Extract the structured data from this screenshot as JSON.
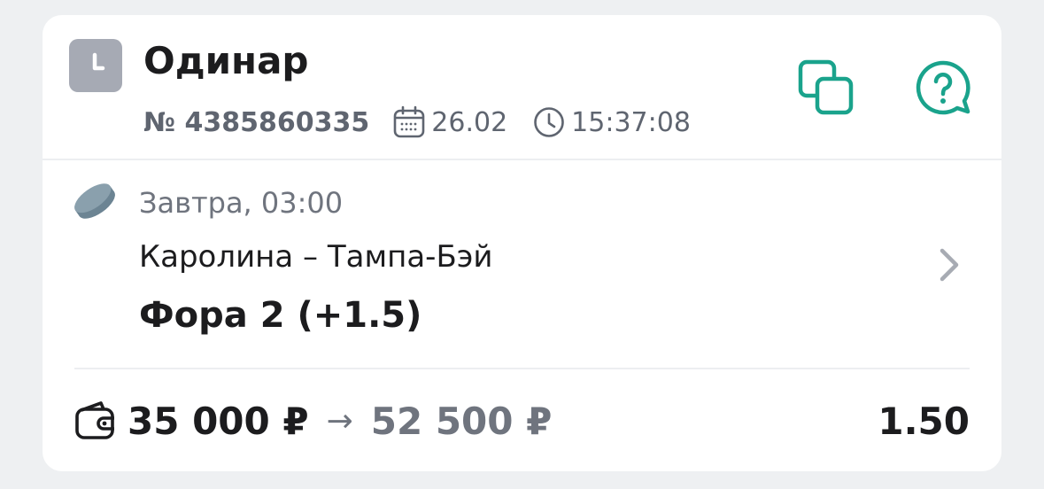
{
  "bet": {
    "type_label": "Одинар",
    "type_icon": "clock-icon",
    "number": "№ 4385860335",
    "date": "26.02",
    "time": "15:37:08"
  },
  "event": {
    "sport_icon": "hockey-puck-icon",
    "start_time": "Завтра, 03:00",
    "teams": "Каролина – Тампа-Бэй",
    "market": "Фора 2 (+1.5)"
  },
  "footer": {
    "stake": "35 000 ₽",
    "arrow": "→",
    "payout": "52 500 ₽",
    "odds": "1.50"
  },
  "colors": {
    "accent": "#1aa38c",
    "muted": "#6f747e",
    "text": "#1c1c1e",
    "icon_gray": "#a6aab4",
    "puck": "#7f95a3",
    "background": "#eef0f2"
  }
}
